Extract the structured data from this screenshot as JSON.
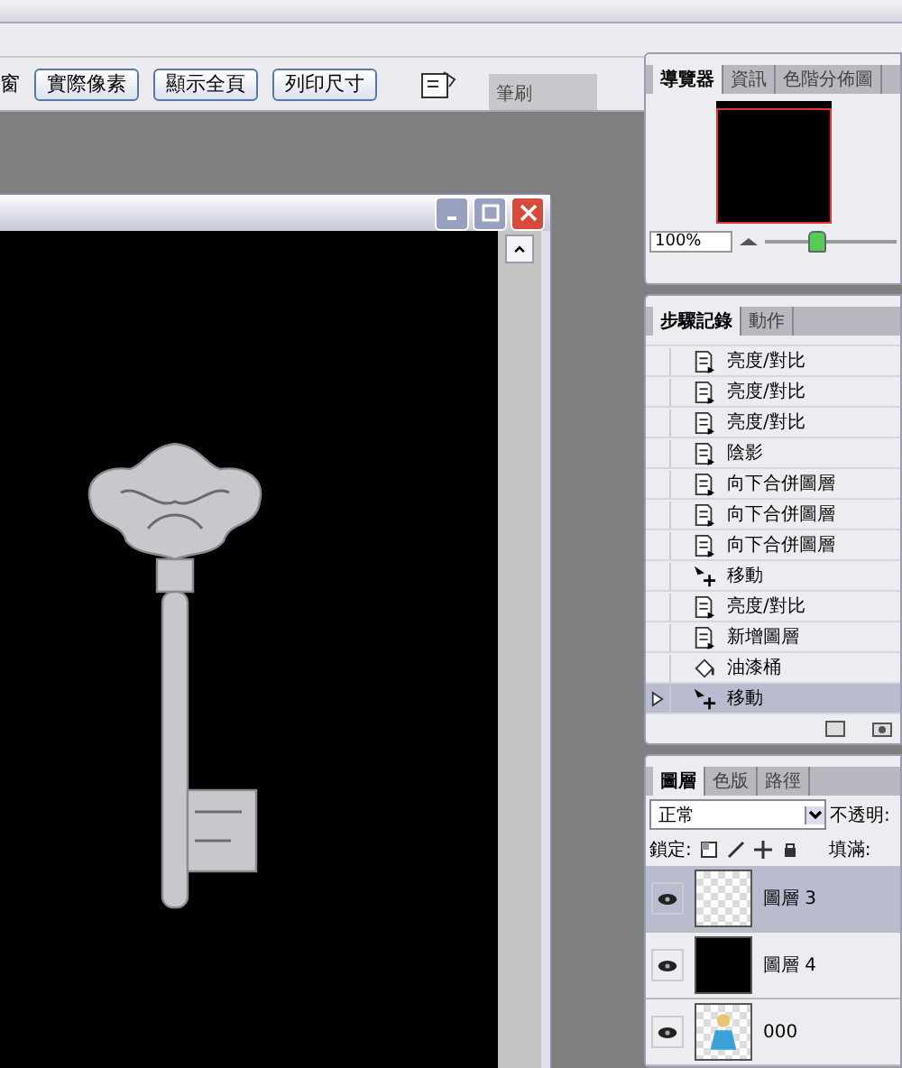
{
  "options_bar": {
    "label": "窗",
    "buttons": [
      "實際像素",
      "顯示全頁",
      "列印尺寸"
    ],
    "well_tabs": [
      {
        "label": "筆刷"
      }
    ]
  },
  "navigator": {
    "tabs": [
      {
        "label": "導覽器",
        "selected": true
      },
      {
        "label": "資訊",
        "selected": false
      },
      {
        "label": "色階分佈圖",
        "selected": false
      }
    ],
    "zoom": "100%",
    "level": 0.4
  },
  "history": {
    "tabs": [
      {
        "label": "步驟記錄",
        "selected": true
      },
      {
        "label": "動作",
        "selected": false
      }
    ],
    "items": [
      {
        "label": "亮度/對比",
        "kind": "command",
        "selected": false
      },
      {
        "label": "亮度/對比",
        "kind": "command",
        "selected": false
      },
      {
        "label": "亮度/對比",
        "kind": "command",
        "selected": false
      },
      {
        "label": "陰影",
        "kind": "command",
        "selected": false
      },
      {
        "label": "向下合併圖層",
        "kind": "command",
        "selected": false
      },
      {
        "label": "向下合併圖層",
        "kind": "command",
        "selected": false
      },
      {
        "label": "向下合併圖層",
        "kind": "command",
        "selected": false
      },
      {
        "label": "移動",
        "kind": "move",
        "selected": false
      },
      {
        "label": "亮度/對比",
        "kind": "command",
        "selected": false
      },
      {
        "label": "新增圖層",
        "kind": "command",
        "selected": false
      },
      {
        "label": "油漆桶",
        "kind": "bucket",
        "selected": false
      },
      {
        "label": "移動",
        "kind": "move",
        "selected": true
      }
    ]
  },
  "layers": {
    "tabs": [
      {
        "label": "圖層",
        "selected": true
      },
      {
        "label": "色版",
        "selected": false
      },
      {
        "label": "路徑",
        "selected": false
      }
    ],
    "blend_mode": "正常",
    "opacity_label": "不透明:",
    "lock_label": "鎖定:",
    "fill_label": "填滿:",
    "items": [
      {
        "name": "圖層 3",
        "kind": "transparent",
        "visible": true,
        "selected": true
      },
      {
        "name": "圖層 4",
        "kind": "black",
        "visible": true,
        "selected": false
      },
      {
        "name": "000",
        "kind": "figure",
        "visible": true,
        "selected": false
      }
    ]
  }
}
